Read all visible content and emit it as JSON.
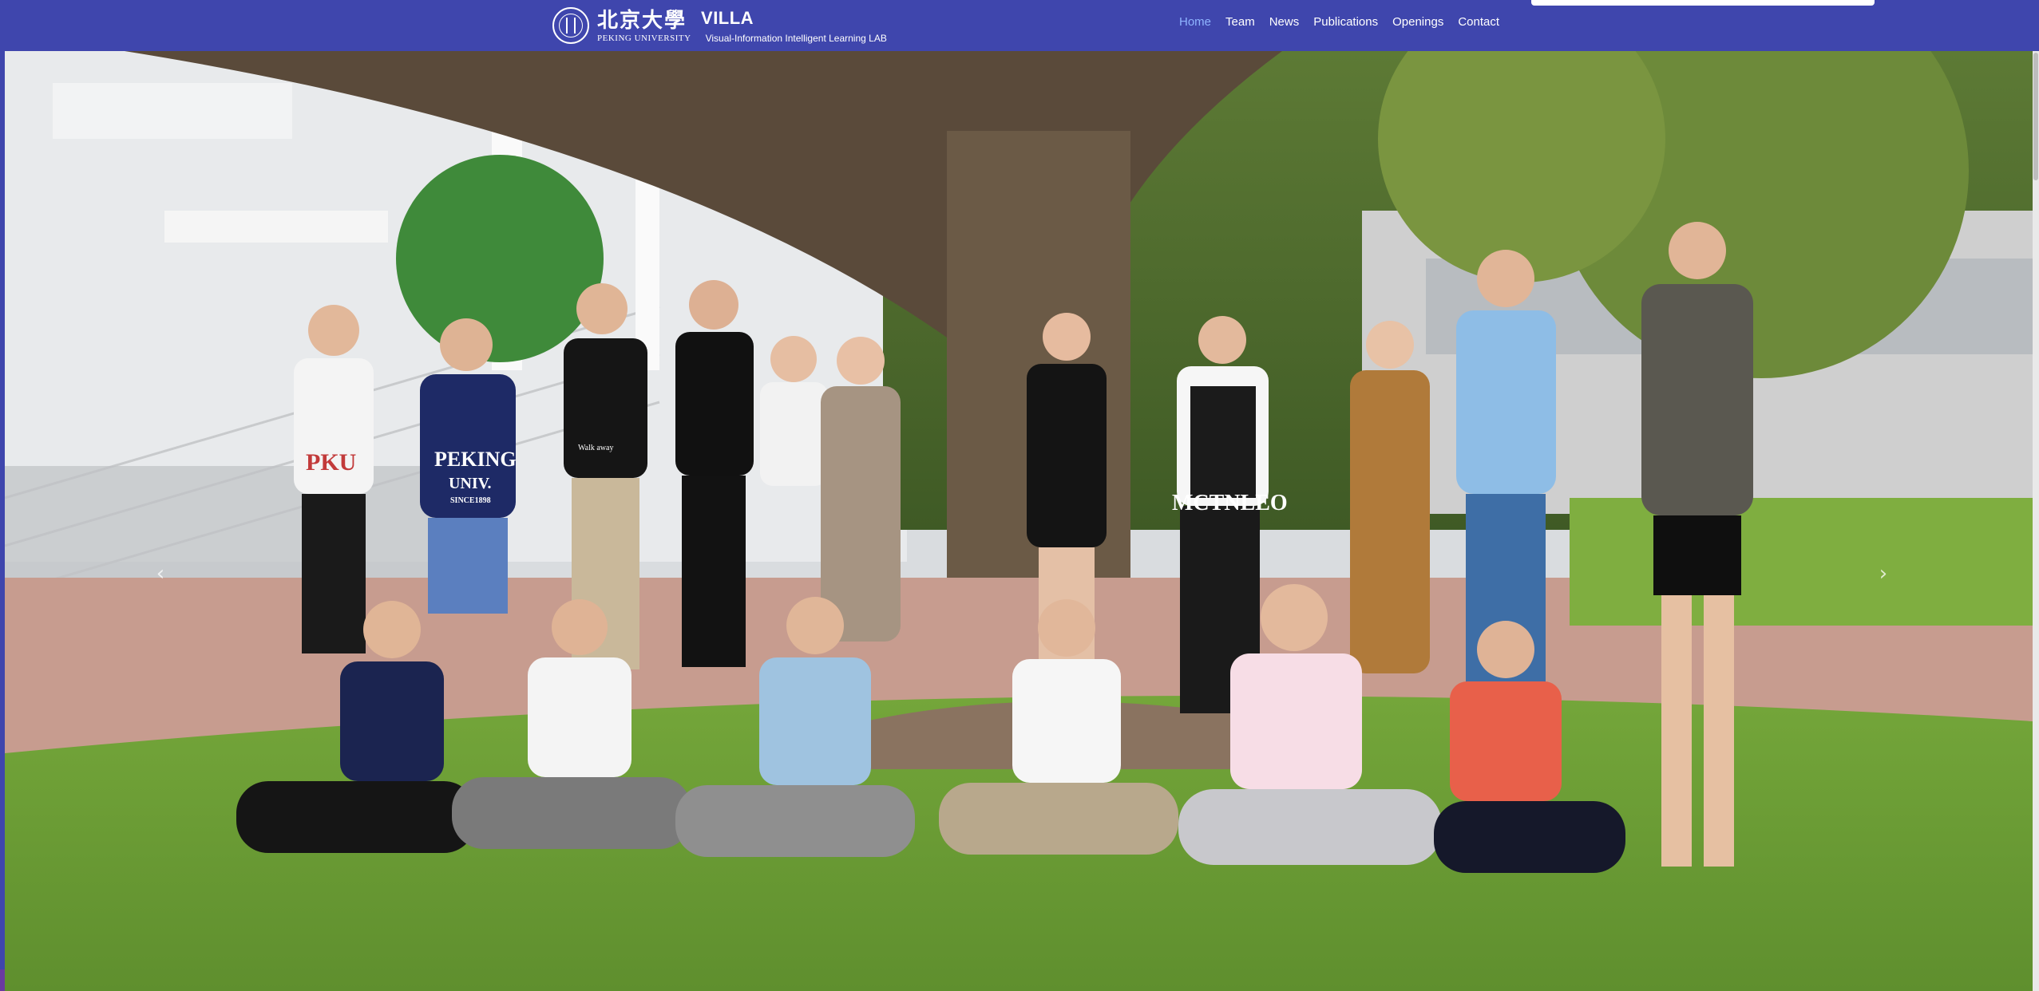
{
  "brand": {
    "name_cn": "北京大學",
    "name_en": "PEKING UNIVERSITY",
    "lab_short": "VILLA",
    "lab_full": "Visual-Information Intelligent Learning LAB"
  },
  "nav": {
    "items": [
      {
        "label": "Home",
        "active": true
      },
      {
        "label": "Team",
        "active": false
      },
      {
        "label": "News",
        "active": false
      },
      {
        "label": "Publications",
        "active": false
      },
      {
        "label": "Openings",
        "active": false
      },
      {
        "label": "Contact",
        "active": false
      }
    ]
  },
  "carousel": {
    "prev_glyph": "‹",
    "next_glyph": "›",
    "slide_count": 2,
    "active_slide": 0,
    "shirt_texts": [
      "PKU",
      "PEKING",
      "UNIV.",
      "SINCE1898",
      "Walk away",
      "MCTNLEO"
    ]
  },
  "colors": {
    "navbar": "#3f46ad",
    "nav_active": "#8fb4ff",
    "nav_text": "#ffffff"
  },
  "icons": {
    "logo": "peking-university-seal-icon",
    "prev": "chevron-left-icon",
    "next": "chevron-right-icon"
  }
}
